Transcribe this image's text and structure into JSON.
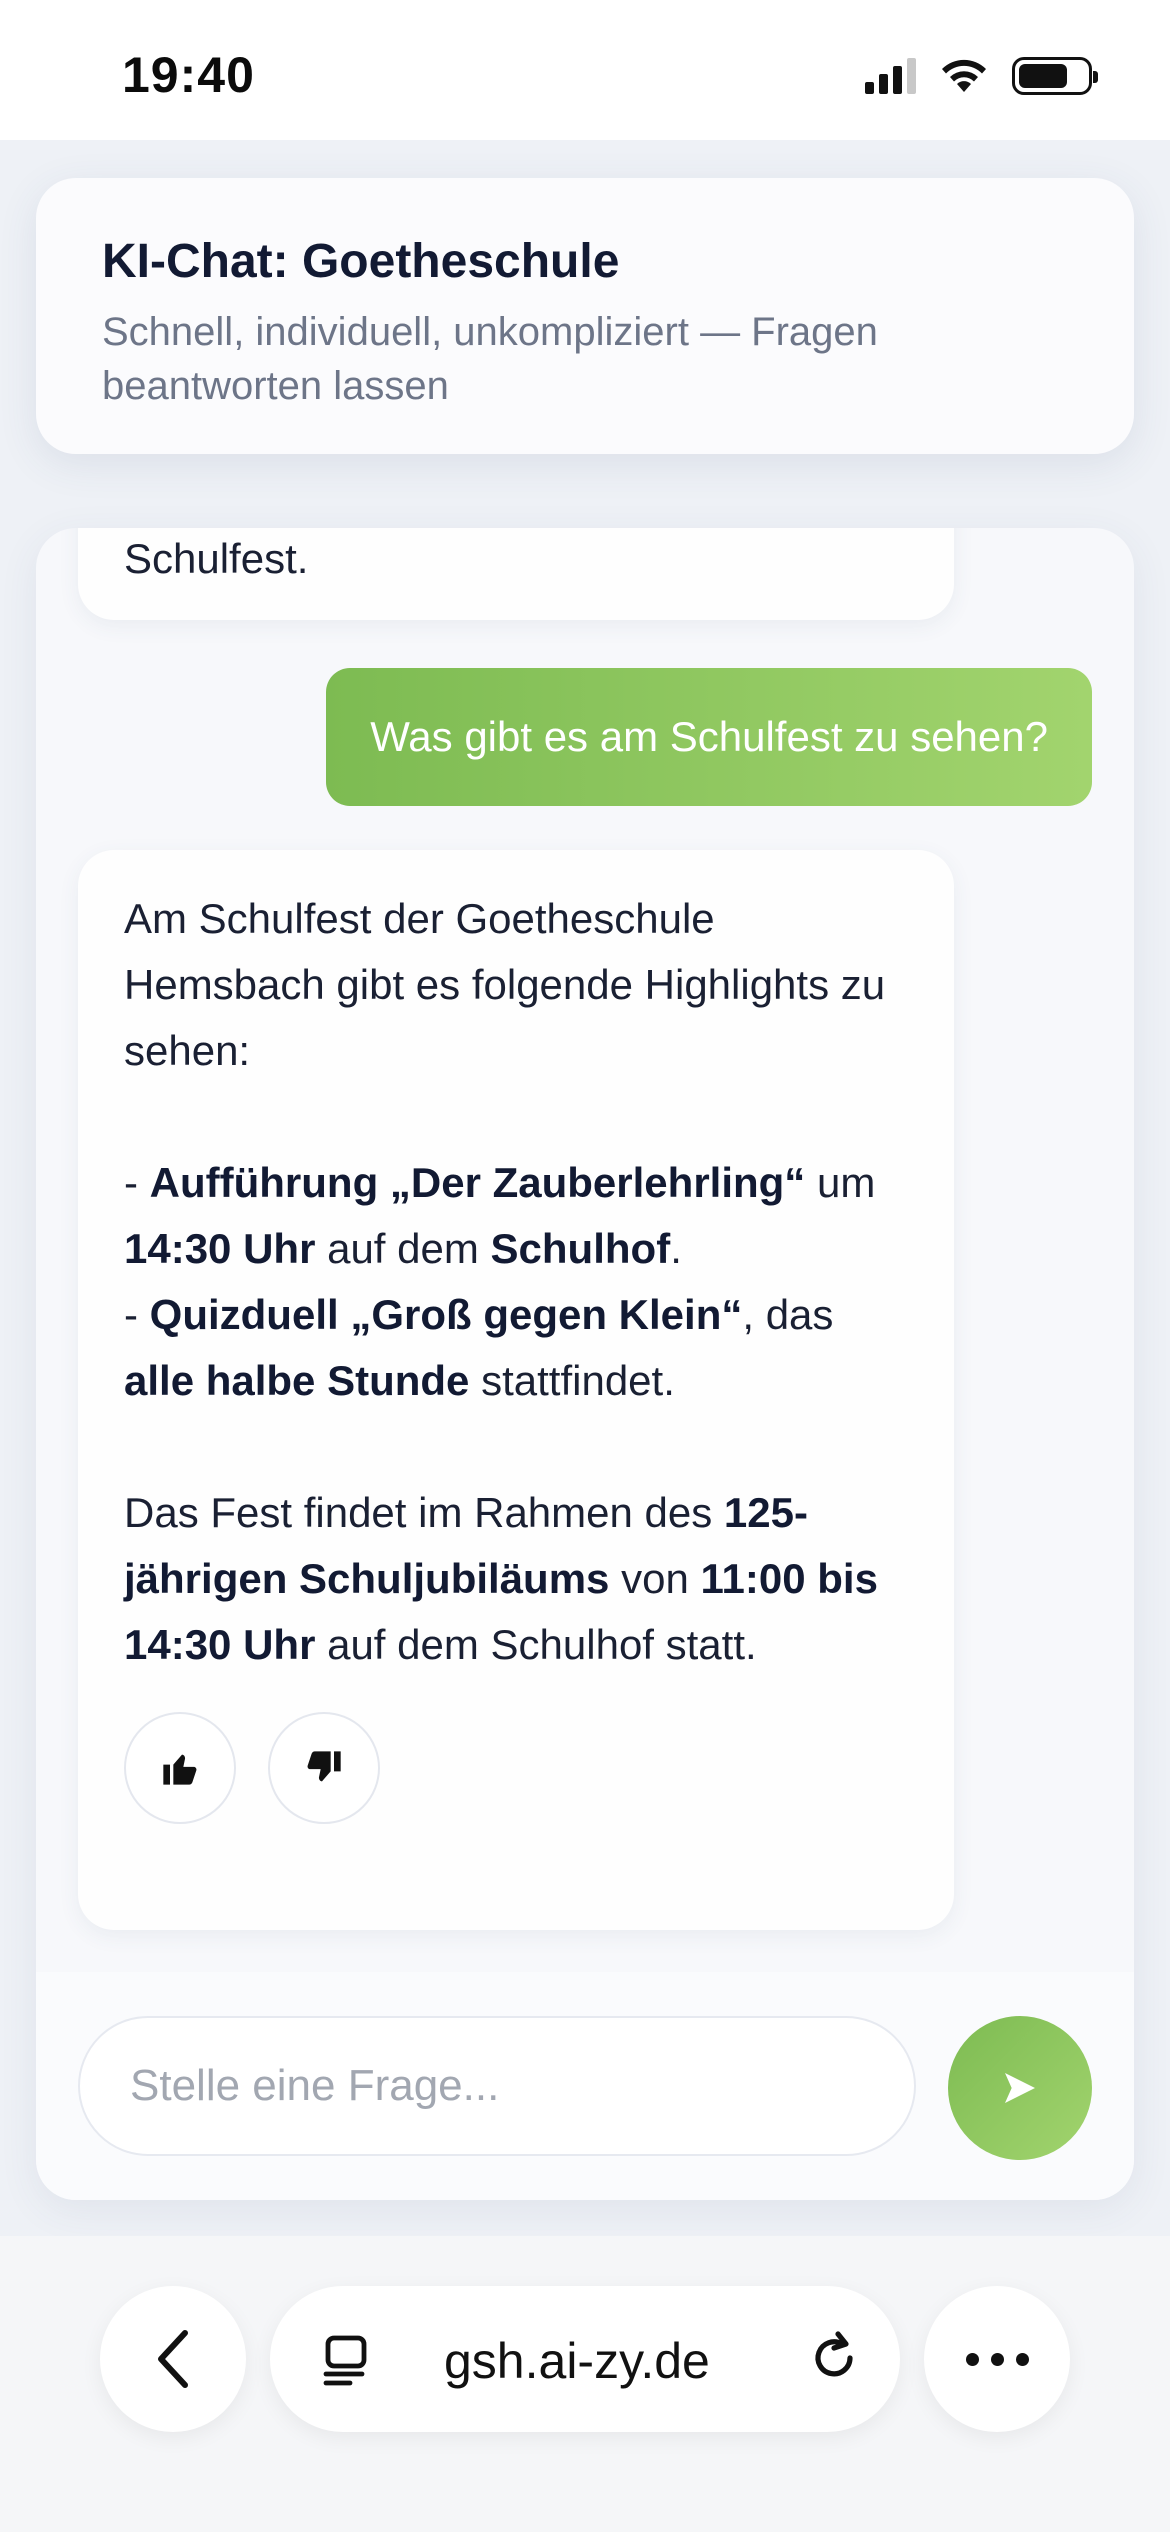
{
  "status_bar": {
    "time": "19:40",
    "icons": [
      "cellular-signal-icon",
      "wifi-icon",
      "battery-icon"
    ]
  },
  "header": {
    "title": "KI-Chat: Goetheschule",
    "subtitle": "Schnell, individuell, unkompliziert — Fragen beantworten lassen"
  },
  "chat": {
    "previous_bot_tail": "Schulfest.",
    "user_message": "Was gibt es am Schulfest zu sehen?",
    "answer": {
      "intro": "Am Schulfest der Goetheschule Hemsbach gibt es folgende Highlights zu sehen:",
      "item1": {
        "prefix": "- ",
        "event": "Aufführung „Der Zauberlehrling“",
        "t1": " um ",
        "time": "14:30 Uhr",
        "t2": " auf dem ",
        "place": "Schulhof",
        "t3": "."
      },
      "item2": {
        "prefix": "- ",
        "event": "Quizduell „Groß gegen Klein“",
        "t1": ", das ",
        "frequency": "alle halbe Stunde",
        "t2": " stattfindet."
      },
      "closing": {
        "t1": "Das Fest findet im Rahmen des ",
        "occasion": "125-jährigen Schuljubiläums",
        "t2": " von ",
        "timespan": "11:00 bis 14:30 Uhr",
        "t3": " auf dem Schulhof statt."
      },
      "feedback_icons": [
        "thumbs-up-icon",
        "thumbs-down-icon"
      ]
    }
  },
  "input": {
    "placeholder": "Stelle eine Frage...",
    "send_icon": "send-arrow-icon"
  },
  "browser": {
    "url": "gsh.ai-zy.de",
    "icons": [
      "back-chevron-icon",
      "tabs-icon",
      "reload-icon",
      "more-icon"
    ]
  },
  "colors": {
    "accent_green": "#7dbb52",
    "accent_green_light": "#a2d46e",
    "background": "#eef1f6"
  }
}
